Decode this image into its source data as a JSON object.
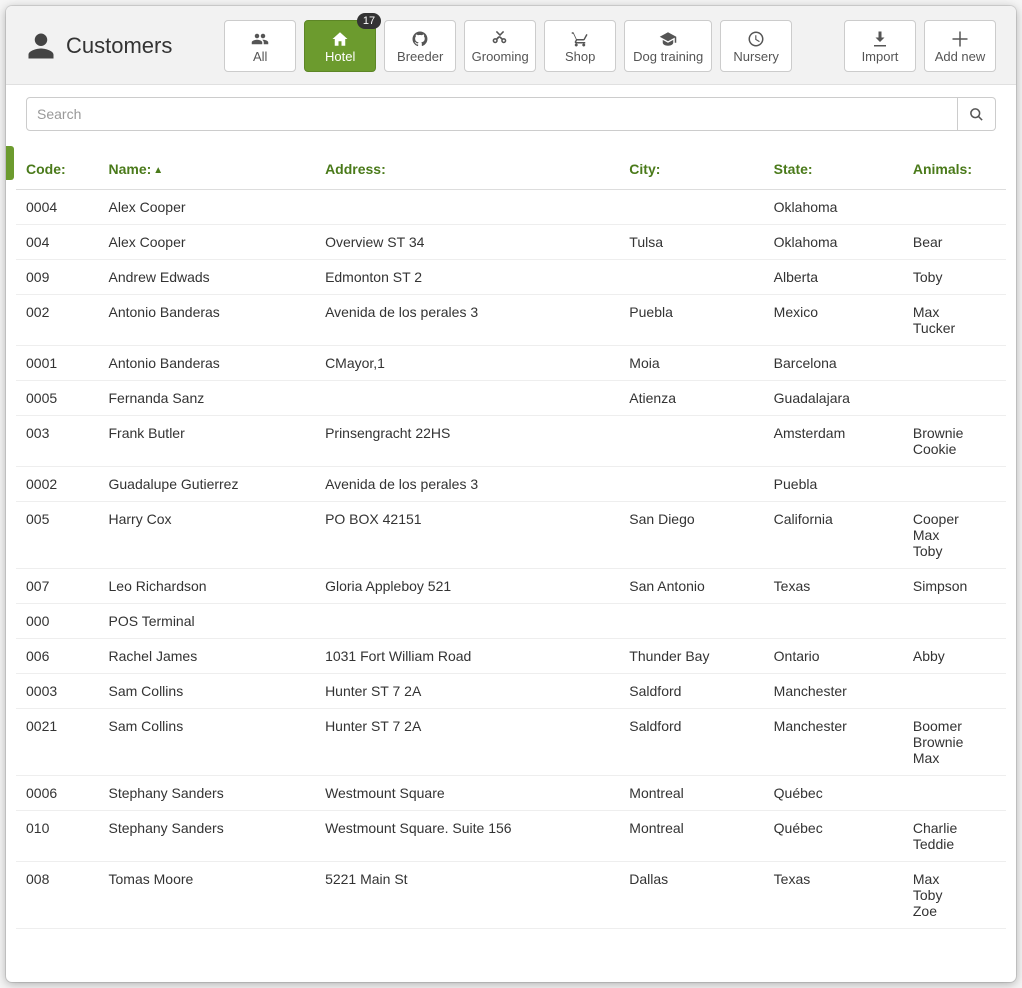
{
  "header": {
    "title": "Customers"
  },
  "tabs": [
    {
      "id": "all",
      "label": "All",
      "active": false,
      "badge": null,
      "wide": false
    },
    {
      "id": "hotel",
      "label": "Hotel",
      "active": true,
      "badge": "17",
      "wide": false
    },
    {
      "id": "breeder",
      "label": "Breeder",
      "active": false,
      "badge": null,
      "wide": false
    },
    {
      "id": "grooming",
      "label": "Grooming",
      "active": false,
      "badge": null,
      "wide": false
    },
    {
      "id": "shop",
      "label": "Shop",
      "active": false,
      "badge": null,
      "wide": false
    },
    {
      "id": "dog-training",
      "label": "Dog training",
      "active": false,
      "badge": null,
      "wide": true
    },
    {
      "id": "nursery",
      "label": "Nursery",
      "active": false,
      "badge": null,
      "wide": false
    }
  ],
  "actions": {
    "import": "Import",
    "add_new": "Add new"
  },
  "search": {
    "placeholder": "Search",
    "value": ""
  },
  "columns": {
    "code": "Code:",
    "name": "Name:",
    "address": "Address:",
    "city": "City:",
    "state": "State:",
    "animals": "Animals:",
    "sorted": "name",
    "sort_dir": "asc"
  },
  "rows": [
    {
      "code": "0004",
      "name": "Alex Cooper",
      "address": "",
      "city": "",
      "state": "Oklahoma",
      "animals": []
    },
    {
      "code": "004",
      "name": "Alex Cooper",
      "address": "Overview ST 34",
      "city": "Tulsa",
      "state": "Oklahoma",
      "animals": [
        "Bear"
      ]
    },
    {
      "code": "009",
      "name": "Andrew Edwads",
      "address": "Edmonton ST 2",
      "city": "",
      "state": "Alberta",
      "animals": [
        "Toby"
      ]
    },
    {
      "code": "002",
      "name": "Antonio Banderas",
      "address": "Avenida de los perales 3",
      "city": "Puebla",
      "state": "Mexico",
      "animals": [
        "Max",
        "Tucker"
      ]
    },
    {
      "code": "0001",
      "name": "Antonio Banderas",
      "address": "CMayor,1",
      "city": "Moia",
      "state": "Barcelona",
      "animals": []
    },
    {
      "code": "0005",
      "name": "Fernanda Sanz",
      "address": "",
      "city": "Atienza",
      "state": "Guadalajara",
      "animals": []
    },
    {
      "code": "003",
      "name": "Frank Butler",
      "address": "Prinsengracht 22HS",
      "city": "",
      "state": "Amsterdam",
      "animals": [
        "Brownie",
        "Cookie"
      ]
    },
    {
      "code": "0002",
      "name": "Guadalupe Gutierrez",
      "address": "Avenida de los perales 3",
      "city": "",
      "state": "Puebla",
      "animals": []
    },
    {
      "code": "005",
      "name": "Harry Cox",
      "address": "PO BOX 42151",
      "city": "San Diego",
      "state": "California",
      "animals": [
        "Cooper",
        "Max",
        "Toby"
      ]
    },
    {
      "code": "007",
      "name": "Leo Richardson",
      "address": "Gloria Appleboy 521",
      "city": "San Antonio",
      "state": "Texas",
      "animals": [
        "Simpson"
      ]
    },
    {
      "code": "000",
      "name": "POS Terminal",
      "address": "",
      "city": "",
      "state": "",
      "animals": []
    },
    {
      "code": "006",
      "name": "Rachel James",
      "address": "1031 Fort William Road",
      "city": "Thunder Bay",
      "state": "Ontario",
      "animals": [
        "Abby"
      ]
    },
    {
      "code": "0003",
      "name": "Sam Collins",
      "address": "Hunter ST 7 2A",
      "city": "Saldford",
      "state": "Manchester",
      "animals": []
    },
    {
      "code": "0021",
      "name": "Sam Collins",
      "address": "Hunter ST 7 2A",
      "city": "Saldford",
      "state": "Manchester",
      "animals": [
        "Boomer",
        "Brownie",
        "Max"
      ]
    },
    {
      "code": "0006",
      "name": "Stephany Sanders",
      "address": "Westmount Square",
      "city": "Montreal",
      "state": "Québec",
      "animals": []
    },
    {
      "code": "010",
      "name": "Stephany Sanders",
      "address": "Westmount Square. Suite 156",
      "city": "Montreal",
      "state": "Québec",
      "animals": [
        "Charlie",
        "Teddie"
      ]
    },
    {
      "code": "008",
      "name": "Tomas Moore",
      "address": "5221 Main St",
      "city": "Dallas",
      "state": "Texas",
      "animals": [
        "Max",
        "Toby",
        "Zoe"
      ]
    }
  ],
  "icons": {
    "all": "users",
    "hotel": "home",
    "breeder": "github",
    "grooming": "cut",
    "shop": "cart",
    "dog-training": "graduation",
    "nursery": "clock"
  }
}
